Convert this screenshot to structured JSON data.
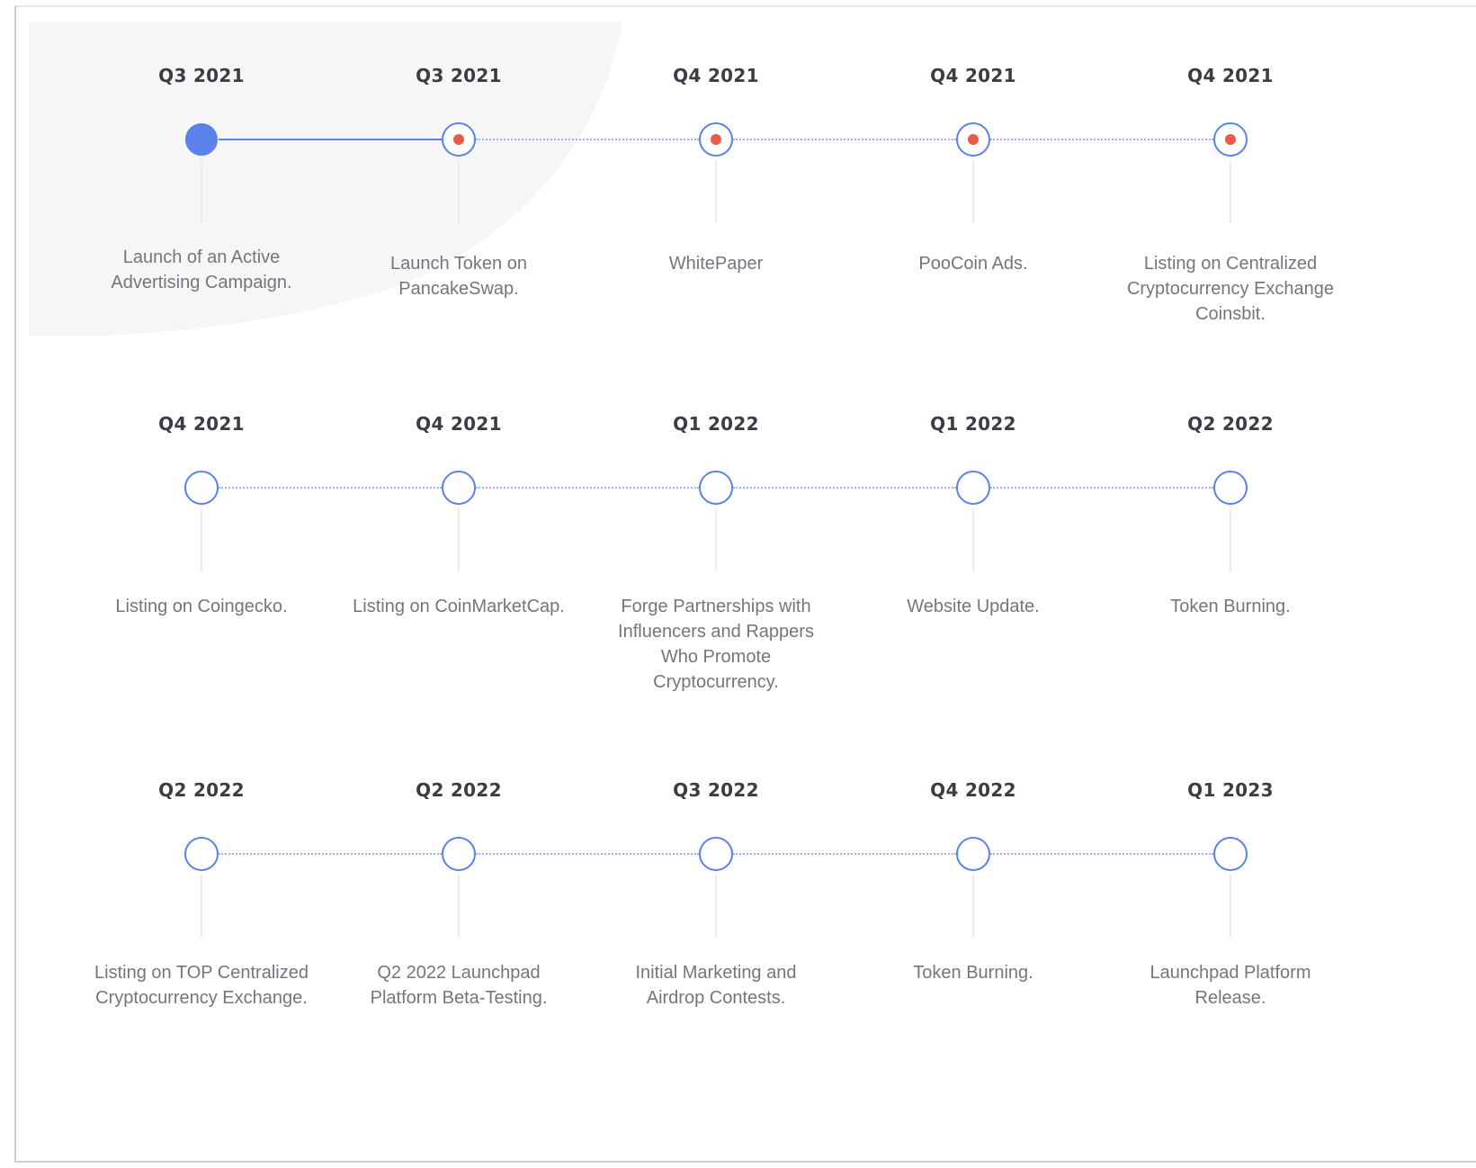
{
  "roadmap": {
    "rows": [
      {
        "items": [
          {
            "quarter": "Q3 2021",
            "description": "Launch of an Active Advertising Campaign.",
            "status": "completed"
          },
          {
            "quarter": "Q3 2021",
            "description": "Launch Token on PancakeSwap.",
            "status": "in-progress"
          },
          {
            "quarter": "Q4 2021",
            "description": "WhitePaper",
            "status": "in-progress"
          },
          {
            "quarter": "Q4 2021",
            "description": "PooCoin Ads.",
            "status": "in-progress"
          },
          {
            "quarter": "Q4 2021",
            "description": "Listing on Centralized Cryptocurrency Exchange Coinsbit.",
            "status": "in-progress"
          }
        ]
      },
      {
        "items": [
          {
            "quarter": "Q4 2021",
            "description": "Listing on Coingecko.",
            "status": "planned"
          },
          {
            "quarter": "Q4 2021",
            "description": "Listing on CoinMarketCap.",
            "status": "planned"
          },
          {
            "quarter": "Q1 2022",
            "description": "Forge Partnerships with Influencers and Rappers Who Promote Cryptocurrency.",
            "status": "planned"
          },
          {
            "quarter": "Q1 2022",
            "description": "Website Update.",
            "status": "planned"
          },
          {
            "quarter": "Q2 2022",
            "description": "Token Burning.",
            "status": "planned"
          }
        ]
      },
      {
        "items": [
          {
            "quarter": "Q2 2022",
            "description": "Listing on TOP Centralized Cryptocurrency Exchange.",
            "status": "planned"
          },
          {
            "quarter": "Q2 2022",
            "description": "Q2 2022 Launchpad Platform Beta-Testing.",
            "status": "planned"
          },
          {
            "quarter": "Q3 2022",
            "description": "Initial Marketing and Airdrop Contests.",
            "status": "planned"
          },
          {
            "quarter": "Q4 2022",
            "description": "Token Burning.",
            "status": "planned"
          },
          {
            "quarter": "Q1 2023",
            "description": "Launchpad Platform Release.",
            "status": "planned"
          }
        ]
      }
    ]
  },
  "colors": {
    "accent": "#5b82ea",
    "in_progress_dot": "#ea5a47",
    "connector_dotted": "#9db4f2",
    "heading": "#3a3d44",
    "text": "#73767d"
  }
}
